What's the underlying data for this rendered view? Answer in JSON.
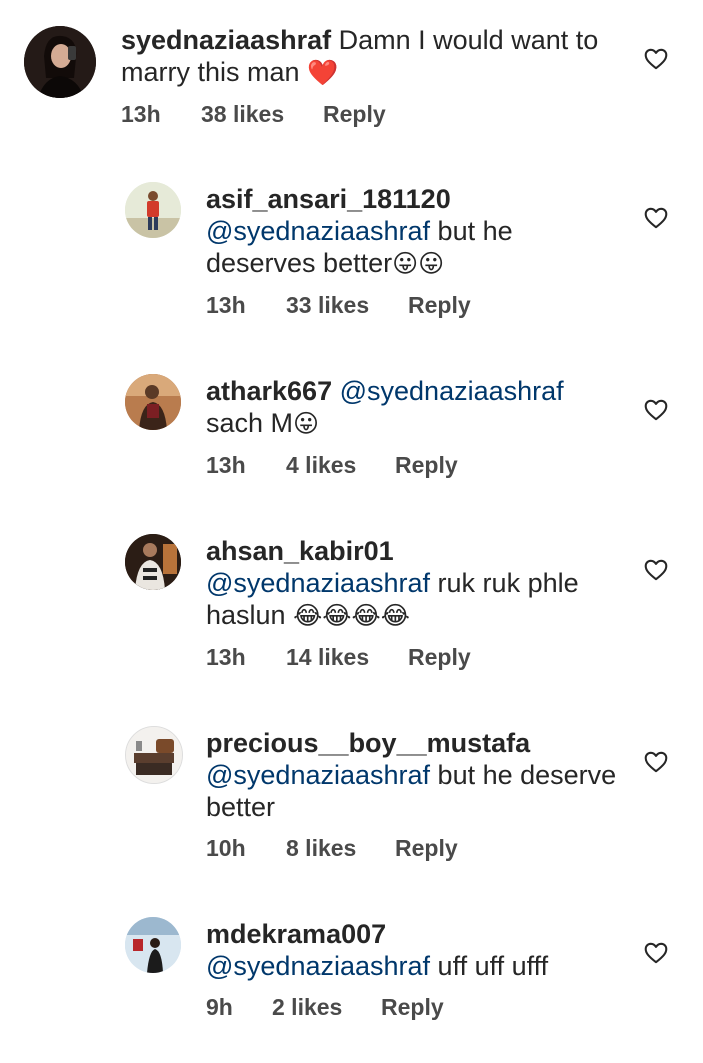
{
  "comments": [
    {
      "username": "syednaziaashraf",
      "mention": "",
      "text": "Damn I would want to marry this man",
      "emoji": "❤️",
      "time": "13h",
      "likes": "38 likes",
      "reply": "Reply",
      "avatar_icon": "profile-photo-dark",
      "reply_level": 0
    },
    {
      "username": "asif_ansari_181120",
      "mention": "@syednaziaashraf",
      "text": "but he deserves better",
      "emoji": "😛😛",
      "time": "13h",
      "likes": "33 likes",
      "reply": "Reply",
      "avatar_icon": "profile-photo-outdoor",
      "reply_level": 1
    },
    {
      "username": "athark667",
      "mention": "@syednaziaashraf",
      "text": "sach M",
      "emoji": "😛",
      "time": "13h",
      "likes": "4 likes",
      "reply": "Reply",
      "avatar_icon": "profile-photo-warm",
      "reply_level": 1
    },
    {
      "username": "ahsan_kabir01",
      "mention": "@syednaziaashraf",
      "text": "ruk ruk phle haslun",
      "emoji": "😂😂😂😂",
      "time": "13h",
      "likes": "14 likes",
      "reply": "Reply",
      "avatar_icon": "profile-photo-night",
      "reply_level": 1
    },
    {
      "username": "precious__boy__mustafa",
      "mention": "@syednaziaashraf",
      "text": "but he deserve better",
      "emoji": "",
      "time": "10h",
      "likes": "8 likes",
      "reply": "Reply",
      "avatar_icon": "profile-photo-room",
      "reply_level": 1
    },
    {
      "username": "mdekrama007",
      "mention": "@syednaziaashraf",
      "text": "uff uff ufff",
      "emoji": "",
      "time": "9h",
      "likes": "2 likes",
      "reply": "Reply",
      "avatar_icon": "profile-photo-blue",
      "reply_level": 1
    }
  ],
  "colors": {
    "text": "#262626",
    "mention": "#00376b",
    "meta": "#4a4a4a",
    "heart_outline": "#262626"
  },
  "like_icon": "heart-outline-icon"
}
